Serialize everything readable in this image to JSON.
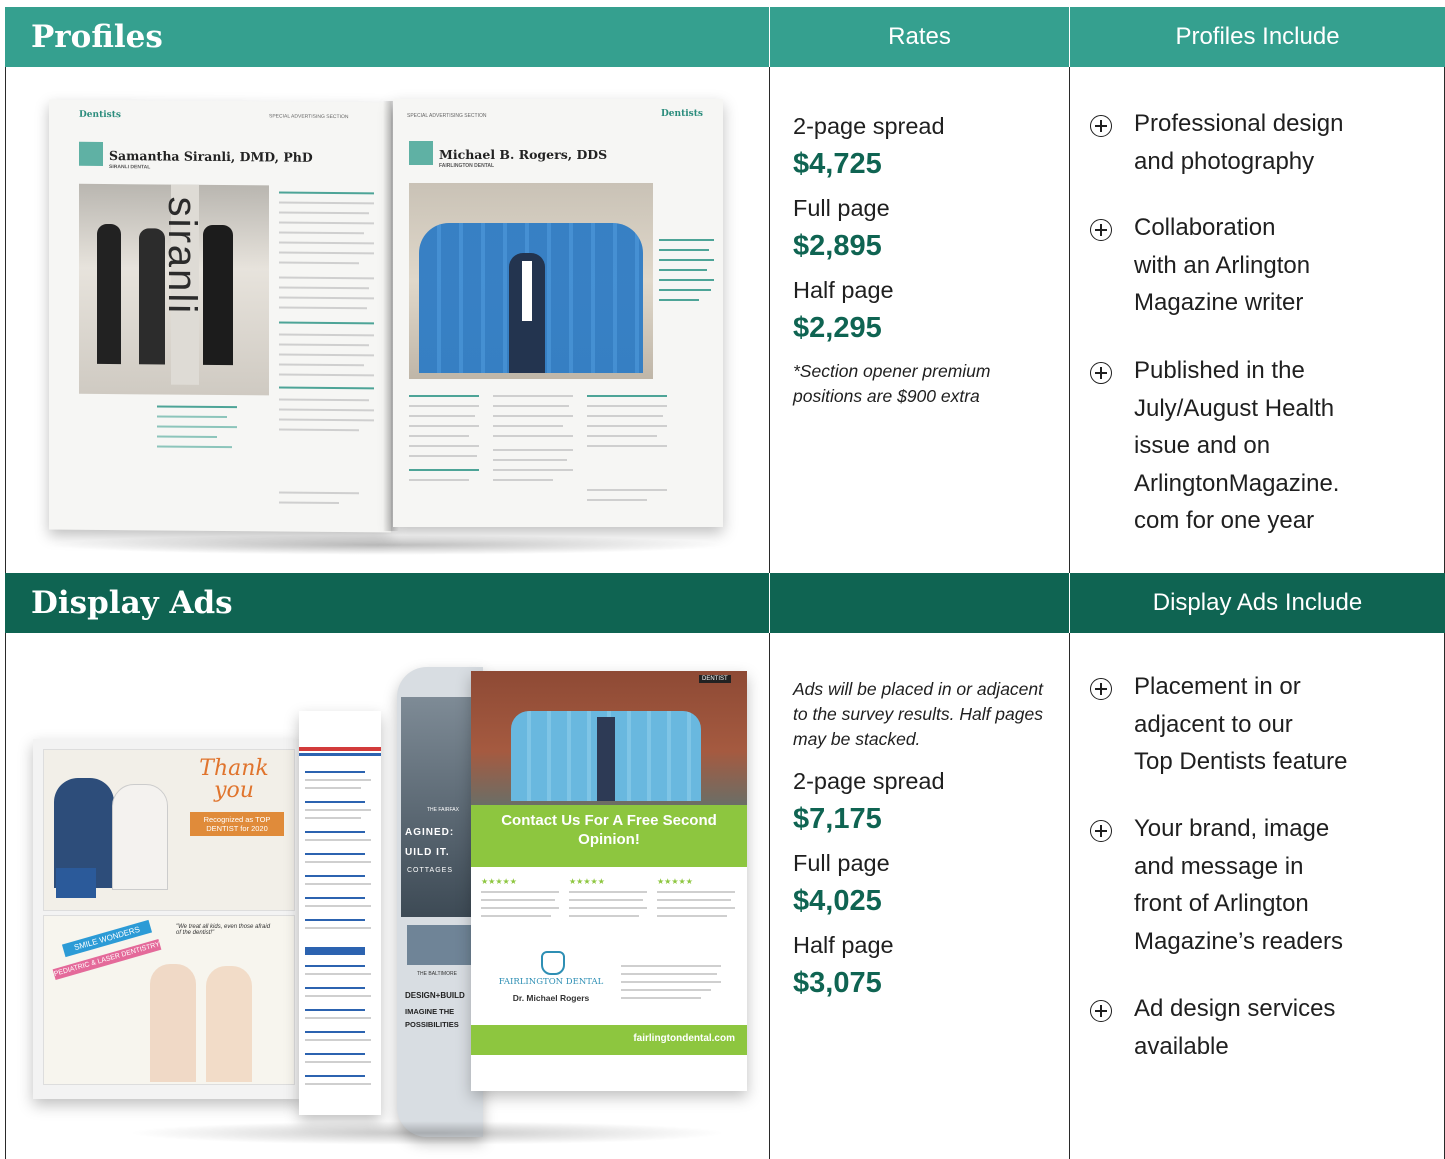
{
  "profiles": {
    "title": "Profiles",
    "rates_header": "Rates",
    "includes_header": "Profiles Include",
    "rates": [
      {
        "label": "2-page spread",
        "price": "$4,725"
      },
      {
        "label": "Full page",
        "price": "$2,895"
      },
      {
        "label": "Half page",
        "price": "$2,295"
      }
    ],
    "note": "*Section opener premium positions are $900 extra",
    "includes": [
      "Professional design\nand photography",
      "Collaboration\nwith an Arlington\nMagazine writer",
      "Published in the\nJuly/August Health\nissue and on\nArlingtonMagazine.\ncom for one year"
    ],
    "image": {
      "left_section": "Dentists",
      "left_name": "Samantha Siranli, DMD, PhD",
      "left_practice": "SIRANLI DENTAL",
      "right_section": "Dentists",
      "right_name": "Michael B. Rogers, DDS",
      "right_practice": "FAIRLINGTON DENTAL",
      "special_section": "SPECIAL ADVERTISING SECTION",
      "brand_vertical": "siranli"
    }
  },
  "display": {
    "title": "Display Ads",
    "includes_header": "Display Ads Include",
    "intro": "Ads will be placed in or adjacent to the survey results. Half pages may be stacked.",
    "rates": [
      {
        "label": "2-page spread",
        "price": "$7,175"
      },
      {
        "label": "Full page",
        "price": "$4,025"
      },
      {
        "label": "Half page",
        "price": "$3,075"
      }
    ],
    "includes": [
      "Placement in or\nadjacent to our\nTop Dentists feature",
      "Your brand, image\nand message in\nfront of Arlington\nMagazine’s readers",
      "Ad design services\navailable"
    ],
    "image": {
      "thank_you": "Thank you",
      "recognized": "Recognized as TOP DENTIST for 2020",
      "smile": "SMILE WONDERS",
      "pediatric": "PEDIATRIC & LASER DENTISTRY",
      "quote": "\"We treat all kids, even those afraid of the dentist!\"",
      "contact": "Contact Us For A Free Second Opinion!",
      "practice": "FAIRLINGTON DENTAL",
      "doctor": "Dr. Michael Rogers",
      "url": "fairlingtondental.com",
      "dentist_sign": "DENTIST",
      "design_build": "DESIGN+BUILD",
      "imagine": "IMAGINE THE POSSIBILITIES",
      "ined": "AGINED:",
      "build": "UILD IT.",
      "cottages": "COTTAGES",
      "fairfax": "THE FAIRFAX",
      "baltimore": "THE BALTIMORE"
    }
  },
  "colors": {
    "teal": "#35a08f",
    "dark_green": "#0f6452",
    "price": "#0f6452"
  },
  "icons": [
    "plus-circle-icon"
  ]
}
